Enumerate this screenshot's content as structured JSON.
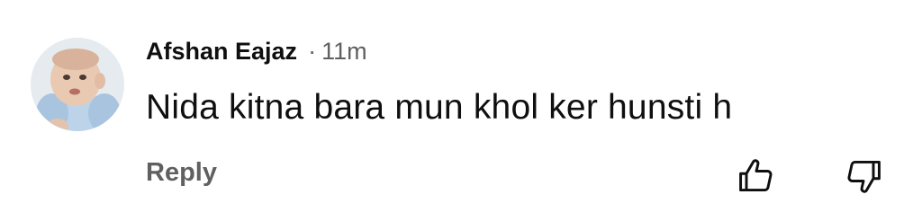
{
  "comment": {
    "author": "Afshan Eajaz",
    "separator": "·",
    "time": "11m",
    "text": "Nida kitna bara mun khol ker hunsti h",
    "reply_label": "Reply"
  },
  "icons": {
    "avatar": "baby-photo-avatar",
    "like": "thumbs-up-icon",
    "dislike": "thumbs-down-icon"
  },
  "colors": {
    "primary_text": "#0f0f0f",
    "secondary_text": "#606060",
    "background": "#ffffff"
  }
}
